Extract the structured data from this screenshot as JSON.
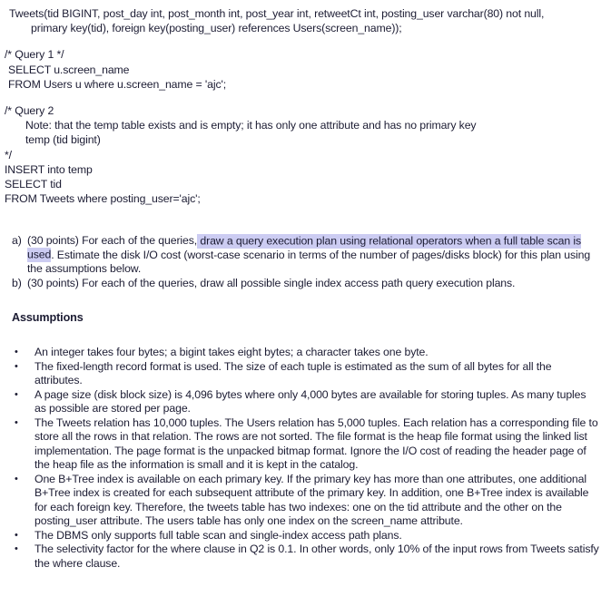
{
  "document": {
    "schema": {
      "lines": [
        "Tweets(tid BIGINT, post_day int, post_month int, post_year int, retweetCt int, posting_user varchar(80) not null,",
        "primary key(tid), foreign key(posting_user) references Users(screen_name));"
      ]
    },
    "query1": {
      "comment": "/* Query 1 */",
      "lines": [
        "SELECT u.screen_name",
        "FROM Users u where u.screen_name = 'ajc';"
      ]
    },
    "query2": {
      "comment_open": "/* Query 2",
      "note": "Note: that the temp table exists and is empty; it has only one attribute and has no primary key",
      "temp_decl": "temp (tid bigint)",
      "comment_close": "*/",
      "lines": [
        "INSERT into temp",
        "SELECT tid",
        "FROM Tweets where posting_user='ajc';"
      ]
    },
    "questions": [
      {
        "marker": "a)",
        "text_before": "(30 points) For each of the queries,",
        "text_highlighted": " draw a query execution plan using relational operators when a full table scan is used",
        "text_after": ". Estimate the disk I/O cost (worst-case scenario in terms of the number of pages/disks block) for this plan using the assumptions below."
      },
      {
        "marker": "b)",
        "text_before": "(30 points) For each of the queries, draw all possible single index access path query execution plans.",
        "text_highlighted": "",
        "text_after": ""
      }
    ],
    "assumptions_heading": "Assumptions",
    "assumptions_bullet": "•",
    "assumptions": [
      "An integer takes four bytes; a bigint takes eight bytes; a character takes one byte.",
      "The fixed-length record format is used. The size of each tuple is estimated as the sum of all bytes for all the attributes.",
      "A page size (disk block size) is 4,096 bytes where only 4,000 bytes are available for storing tuples. As many tuples as possible are stored per page.",
      "The Tweets relation has 10,000 tuples. The Users relation has 5,000 tuples. Each relation has a corresponding file to store all the rows in that relation. The rows are not sorted. The file format is the heap file format using the linked list implementation. The page format is the unpacked bitmap format. Ignore the I/O cost of reading the header page of the heap file as the information is small and it is kept in the catalog.",
      "One B+Tree index is available on each primary key. If the primary key has more than one attributes, one additional B+Tree index is created for each subsequent attribute of the primary key. In addition, one B+Tree index is available for each foreign key. Therefore, the tweets table has two indexes: one on the tid attribute and the other on the posting_user attribute. The users table has only one index on the screen_name attribute.",
      "The DBMS only supports full table scan and single-index access path plans.",
      "The selectivity factor for the where clause in Q2 is 0.1. In other words, only 10% of the input rows from Tweets satisfy the where clause."
    ],
    "colors": {
      "text": "#1c1c33",
      "highlight": "#ccccf2",
      "background": "#ffffff"
    }
  }
}
